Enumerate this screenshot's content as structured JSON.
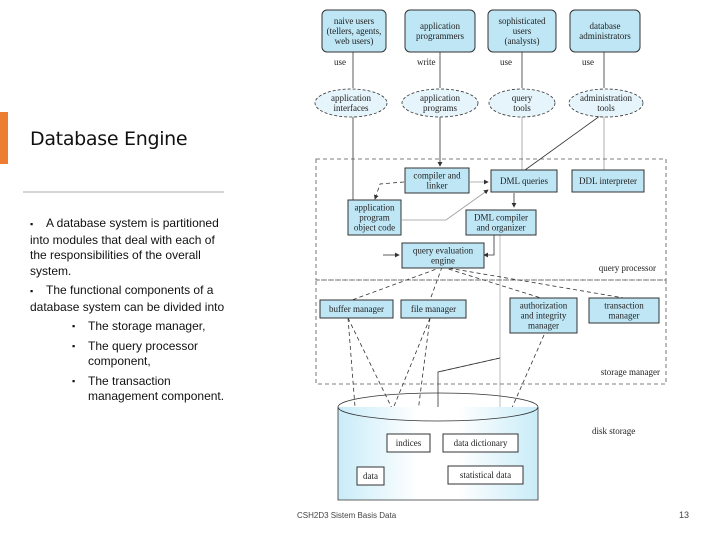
{
  "slide": {
    "title": "Database Engine",
    "accent_color": "#ed7d31",
    "bullets": [
      "A database system is partitioned into modules that deal with each of the responsibilities of the overall system.",
      "The functional components of a database system can be divided into"
    ],
    "sub_bullets": [
      "The storage manager,",
      "The  query processor component,",
      "The transaction management component."
    ],
    "footer": "CSH2D3 Sistem Basis Data",
    "page_number": "13"
  },
  "diagram": {
    "users": [
      {
        "lines": [
          "naive users",
          "(tellers, agents,",
          "web users)"
        ],
        "verb": "use"
      },
      {
        "lines": [
          "application",
          "programmers"
        ],
        "verb": "write"
      },
      {
        "lines": [
          "sophisticated",
          "users",
          "(analysts)"
        ],
        "verb": "use"
      },
      {
        "lines": [
          "database",
          "administrators"
        ],
        "verb": "use"
      }
    ],
    "tools": [
      {
        "lines": [
          "application",
          "interfaces"
        ]
      },
      {
        "lines": [
          "application",
          "programs"
        ]
      },
      {
        "lines": [
          "query",
          "tools"
        ]
      },
      {
        "lines": [
          "administration",
          "tools"
        ]
      }
    ],
    "query_processor": {
      "label": "query processor",
      "compiler_linker": [
        "compiler and",
        "linker"
      ],
      "dml_queries": [
        "DML queries"
      ],
      "ddl_interpreter": [
        "DDL interpreter"
      ],
      "app_object_code": [
        "application",
        "program",
        "object code"
      ],
      "dml_compiler": [
        "DML compiler",
        "and organizer"
      ],
      "query_eval_engine": [
        "query evaluation",
        "engine"
      ]
    },
    "storage_manager": {
      "label": "storage manager",
      "buffer_manager": [
        "buffer manager"
      ],
      "file_manager": [
        "file manager"
      ],
      "auth_integrity": [
        "authorization",
        "and integrity",
        "manager"
      ],
      "transaction_manager": [
        "transaction",
        "manager"
      ]
    },
    "disk_storage": {
      "label": "disk storage",
      "indices": [
        "indices"
      ],
      "data_dictionary": [
        "data dictionary"
      ],
      "data": [
        "data"
      ],
      "statistical_data": [
        "statistical data"
      ]
    },
    "colors": {
      "box_fill": "#bfe6f5",
      "ellipse_fill": "#e6f5fb",
      "line": "#333333"
    }
  }
}
